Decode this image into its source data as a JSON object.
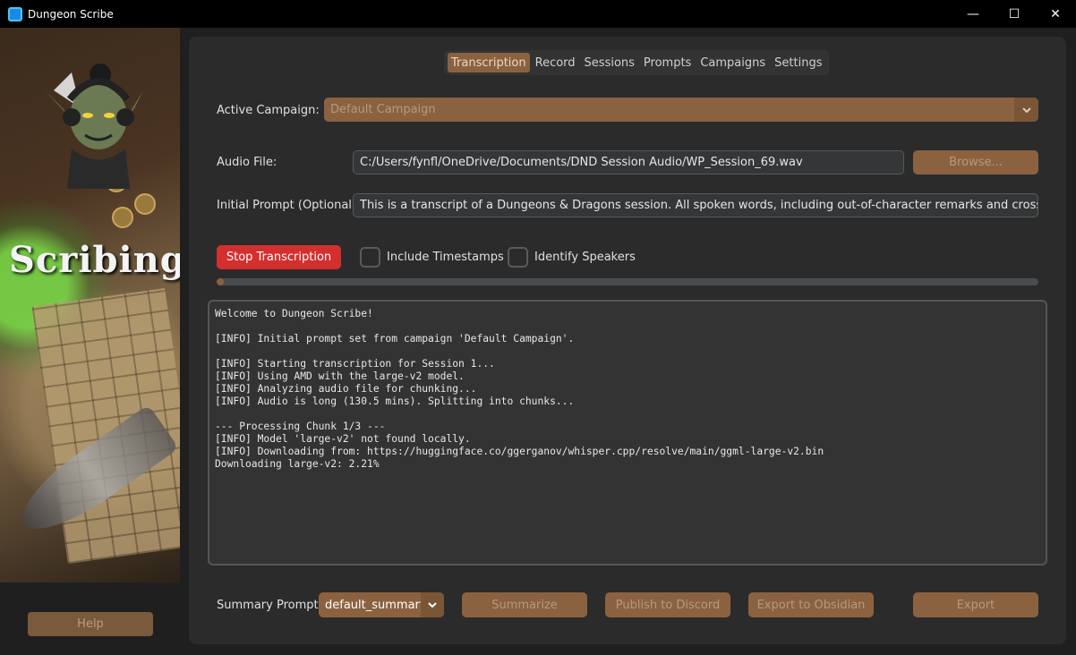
{
  "window": {
    "title": "Dungeon Scribe",
    "minimize_glyph": "—",
    "maximize_glyph": "☐",
    "close_glyph": "✕"
  },
  "sidebar": {
    "banner_text": "Scribing",
    "help_label": "Help"
  },
  "tabs": [
    {
      "label": "Transcription",
      "active": true
    },
    {
      "label": "Record",
      "active": false
    },
    {
      "label": "Sessions",
      "active": false
    },
    {
      "label": "Prompts",
      "active": false
    },
    {
      "label": "Campaigns",
      "active": false
    },
    {
      "label": "Settings",
      "active": false
    }
  ],
  "campaign": {
    "label": "Active Campaign:",
    "selected": "Default Campaign"
  },
  "audio": {
    "label": "Audio File:",
    "value": "C:/Users/fynfl/OneDrive/Documents/DND Session Audio/WP_Session_69.wav",
    "browse_label": "Browse..."
  },
  "prompt": {
    "label": "Initial Prompt (Optional):",
    "value": "This is a transcript of a Dungeons & Dragons session. All spoken words, including out-of-character remarks and crosstalk, should"
  },
  "controls": {
    "stop_label": "Stop Transcription",
    "timestamps_label": "Include Timestamps",
    "timestamps_checked": false,
    "speakers_label": "Identify Speakers",
    "speakers_checked": false
  },
  "progress": {
    "fraction": 0.0082
  },
  "console_lines": [
    "Welcome to Dungeon Scribe!",
    "",
    "[INFO] Initial prompt set from campaign 'Default Campaign'.",
    "",
    "[INFO] Starting transcription for Session 1...",
    "[INFO] Using AMD with the large-v2 model.",
    "[INFO] Analyzing audio file for chunking...",
    "[INFO] Audio is long (130.5 mins). Splitting into chunks...",
    "",
    "--- Processing Chunk 1/3 ---",
    "[INFO] Model 'large-v2' not found locally.",
    "[INFO] Downloading from: https://huggingface.co/ggerganov/whisper.cpp/resolve/main/ggml-large-v2.bin",
    "Downloading large-v2: 2.21%"
  ],
  "summary": {
    "label": "Summary Prompt:",
    "selected": "default_summary",
    "summarize_label": "Summarize",
    "discord_label": "Publish to Discord",
    "obsidian_label": "Export to Obsidian",
    "export_label": "Export"
  },
  "colors": {
    "accent": "#8b623f",
    "stop_red": "#d32f2f",
    "panel": "#2b2b2b",
    "input_bg": "#343638"
  }
}
